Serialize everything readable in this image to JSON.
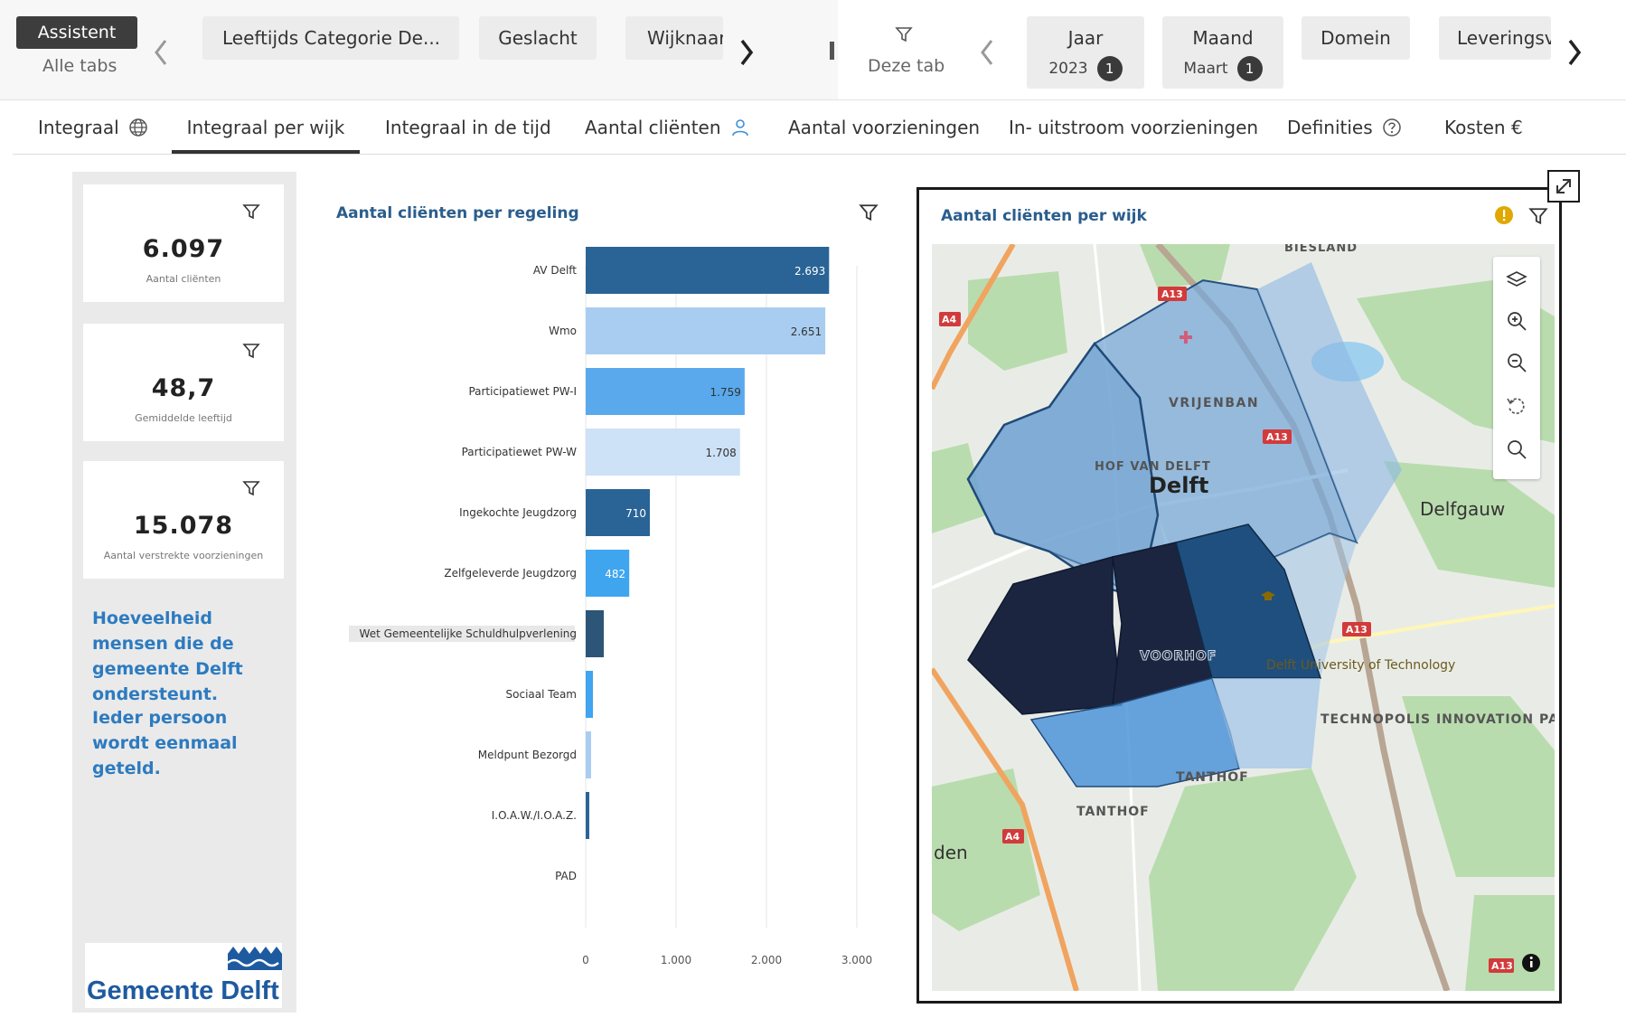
{
  "topbar": {
    "assistant_label": "Assistent",
    "all_tabs_label": "Alle tabs",
    "filters_left": [
      "Leeftijds Categorie De...",
      "Geslacht",
      "Wijknaar"
    ],
    "this_tab_label": "Deze tab",
    "filters_right": [
      {
        "label": "Jaar",
        "value": "2023",
        "count": "1"
      },
      {
        "label": "Maand",
        "value": "Maart",
        "count": "1"
      },
      {
        "label": "Domein"
      },
      {
        "label": "Leveringsv"
      }
    ]
  },
  "tabs": [
    {
      "label": "Integraal",
      "icon": "globe-icon"
    },
    {
      "label": "Integraal per wijk",
      "active": true
    },
    {
      "label": "Integraal in de tijd"
    },
    {
      "label": "Aantal cliënten",
      "icon": "person-icon"
    },
    {
      "label": "Aantal voorzieningen"
    },
    {
      "label": "In- uitstroom voorzieningen"
    },
    {
      "label": "Definities",
      "icon": "help-icon"
    },
    {
      "label": "Kosten €"
    }
  ],
  "kpis": [
    {
      "value": "6.097",
      "label": "Aantal cliënten"
    },
    {
      "value": "48,7",
      "label": "Gemiddelde leeftijd"
    },
    {
      "value": "15.078",
      "label": "Aantal verstrekte voorzieningen"
    }
  ],
  "sidebar_notes": [
    "Hoeveelheid mensen die de gemeente Delft ondersteunt.",
    "Ieder persoon wordt eenmaal geteld."
  ],
  "logo": {
    "text": "Gemeente Delft"
  },
  "chart_data": {
    "type": "bar",
    "orientation": "horizontal",
    "title": "Aantal cliënten per regeling",
    "categories": [
      "AV Delft",
      "Wmo",
      "Participatiewet PW-I",
      "Participatiewet PW-W",
      "Ingekochte Jeugdzorg",
      "Zelfgeleverde Jeugdzorg",
      "Wet Gemeentelijke Schuldhulpverlening",
      "Sociaal Team",
      "Meldpunt Bezorgd",
      "I.O.A.W./I.O.A.Z.",
      "PAD"
    ],
    "values": [
      2693,
      2651,
      1759,
      1708,
      710,
      482,
      200,
      80,
      60,
      40,
      0
    ],
    "data_labels": [
      "2.693",
      "2.651",
      "1.759",
      "1.708",
      "710",
      "482",
      "",
      "",
      "",
      "",
      ""
    ],
    "colors": [
      "#2a6496",
      "#a9cdf0",
      "#59a9ec",
      "#cde1f7",
      "#2a6496",
      "#3fa5ef",
      "#2c5577",
      "#3fa5ef",
      "#a9cdf0",
      "#2a6496",
      "#a9cdf0"
    ],
    "xlim": [
      0,
      3000
    ],
    "xticks": [
      "0",
      "1.000",
      "2.000",
      "3.000"
    ],
    "grid": true
  },
  "map": {
    "title": "Aantal cliënten per wijk",
    "labels": [
      "BIESLAND",
      "VRIJENBAN",
      "HOF VAN DELFT",
      "Delft",
      "Delfgauw",
      "VOORHOF",
      "Delft University of Technology",
      "TECHNOPOLIS INNOVATION PARK DELFT",
      "TANTHOF",
      "TANTHOF",
      "den"
    ],
    "road_labels": [
      "A13",
      "A4",
      "A13",
      "A13",
      "A4",
      "A13"
    ]
  },
  "colors": {
    "accent": "#2d7bc0",
    "title": "#2a5d8c",
    "dark_region": "#1c2540",
    "mid_region": "#1f4f7e"
  }
}
